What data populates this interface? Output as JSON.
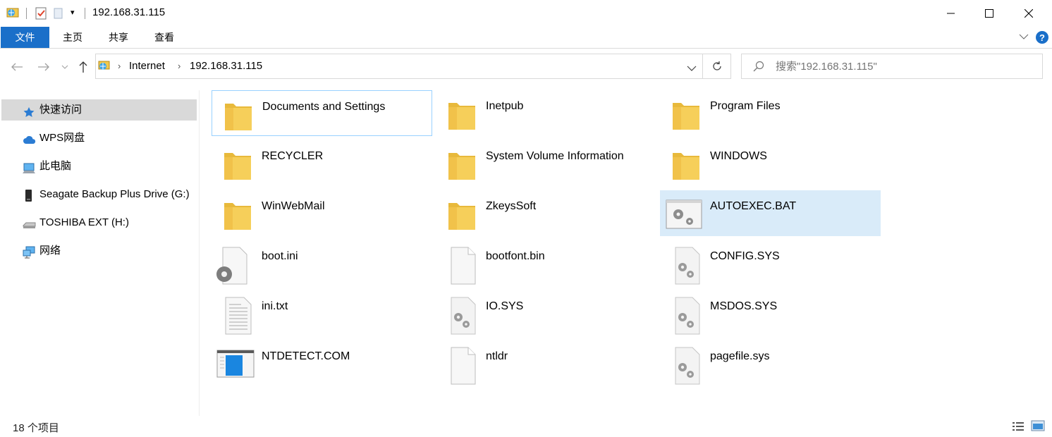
{
  "window": {
    "title": "192.168.31.115",
    "quick_access_dropdown": "▾"
  },
  "ribbon": {
    "tabs": [
      {
        "label": "文件"
      },
      {
        "label": "主页"
      },
      {
        "label": "共享"
      },
      {
        "label": "查看"
      }
    ]
  },
  "address": {
    "crumbs": [
      "Internet",
      "192.168.31.115"
    ],
    "separator": "›"
  },
  "search": {
    "placeholder": "搜索\"192.168.31.115\""
  },
  "nav_pane": {
    "items": [
      {
        "label": "快速访问",
        "icon": "star-icon"
      },
      {
        "label": "WPS网盘",
        "icon": "cloud-icon"
      },
      {
        "label": "此电脑",
        "icon": "computer-icon"
      },
      {
        "label": "Seagate Backup Plus Drive (G:)",
        "icon": "external-drive-icon"
      },
      {
        "label": "TOSHIBA EXT (H:)",
        "icon": "usb-drive-icon"
      },
      {
        "label": "网络",
        "icon": "network-icon"
      }
    ]
  },
  "files": [
    {
      "name": "Documents and Settings",
      "type": "folder"
    },
    {
      "name": "Inetpub",
      "type": "folder"
    },
    {
      "name": "Program Files",
      "type": "folder"
    },
    {
      "name": "RECYCLER",
      "type": "folder"
    },
    {
      "name": "System Volume Information",
      "type": "folder"
    },
    {
      "name": "WINDOWS",
      "type": "folder"
    },
    {
      "name": "WinWebMail",
      "type": "folder"
    },
    {
      "name": "ZkeysSoft",
      "type": "folder"
    },
    {
      "name": "AUTOEXEC.BAT",
      "type": "batch"
    },
    {
      "name": "boot.ini",
      "type": "settings-file"
    },
    {
      "name": "bootfont.bin",
      "type": "blank-file"
    },
    {
      "name": "CONFIG.SYS",
      "type": "system-file"
    },
    {
      "name": "ini.txt",
      "type": "text-file"
    },
    {
      "name": "IO.SYS",
      "type": "system-file"
    },
    {
      "name": "MSDOS.SYS",
      "type": "system-file"
    },
    {
      "name": "NTDETECT.COM",
      "type": "executable"
    },
    {
      "name": "ntldr",
      "type": "blank-file"
    },
    {
      "name": "pagefile.sys",
      "type": "system-file"
    }
  ],
  "status": {
    "item_count": "18 个项目"
  },
  "colors": {
    "accent": "#1a6fc9",
    "selection": "#d9ebf9",
    "focus_border": "#99d1ff",
    "folder": "#f6cf5a"
  }
}
